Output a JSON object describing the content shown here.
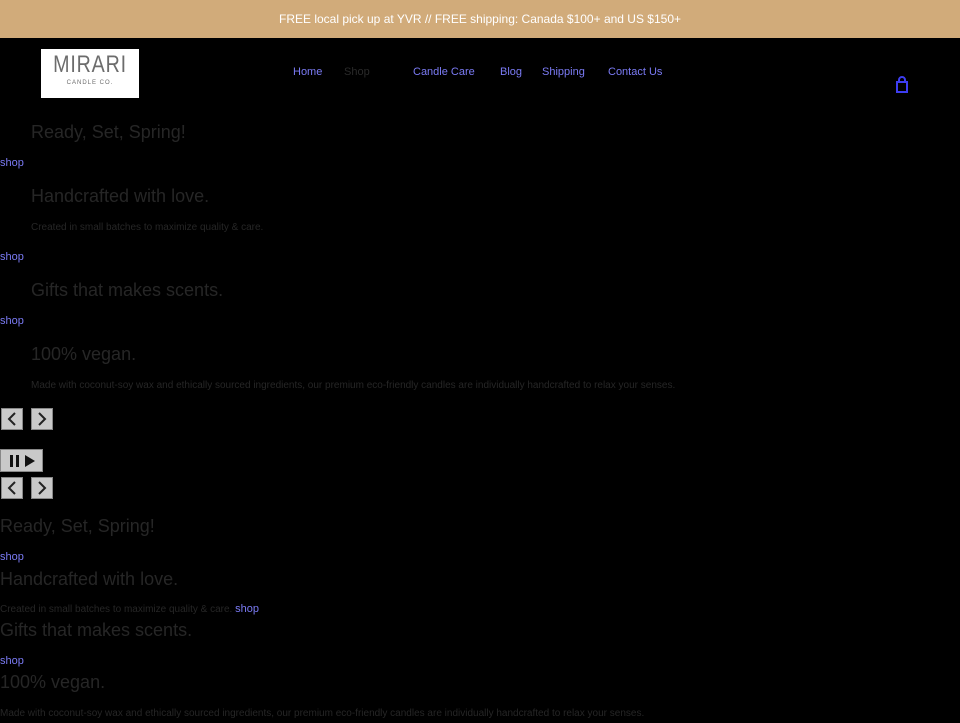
{
  "announcement": "FREE local pick up at YVR // FREE shipping: Canada $100+ and US $150+",
  "logo": {
    "main": "MIRARI",
    "sub": "CANDLE CO."
  },
  "nav": {
    "home": "Home",
    "shop": "Shop",
    "candle_care": "Candle Care",
    "blog": "Blog",
    "shipping": "Shipping",
    "contact": "Contact Us"
  },
  "icons": {
    "cart": "cart-icon",
    "prev": "chevron-left-icon",
    "next": "chevron-right-icon",
    "pause": "pause-icon",
    "play": "play-icon"
  },
  "colors": {
    "announcement_bg": "#d1ab7a",
    "link": "#7b7bf5",
    "page_bg": "#000000"
  },
  "slides": [
    {
      "heading": "Ready, Set, Spring!",
      "text": "",
      "link": "shop"
    },
    {
      "heading": "Handcrafted with love.",
      "text": "Created in small batches to maximize quality & care.",
      "link": "shop"
    },
    {
      "heading": "Gifts that makes scents.",
      "text": "",
      "link": "shop"
    },
    {
      "heading": "100% vegan.",
      "text": "Made with coconut-soy wax and ethically sourced ingredients, our premium eco-friendly candles are individually handcrafted to relax your senses.",
      "link": ""
    }
  ]
}
